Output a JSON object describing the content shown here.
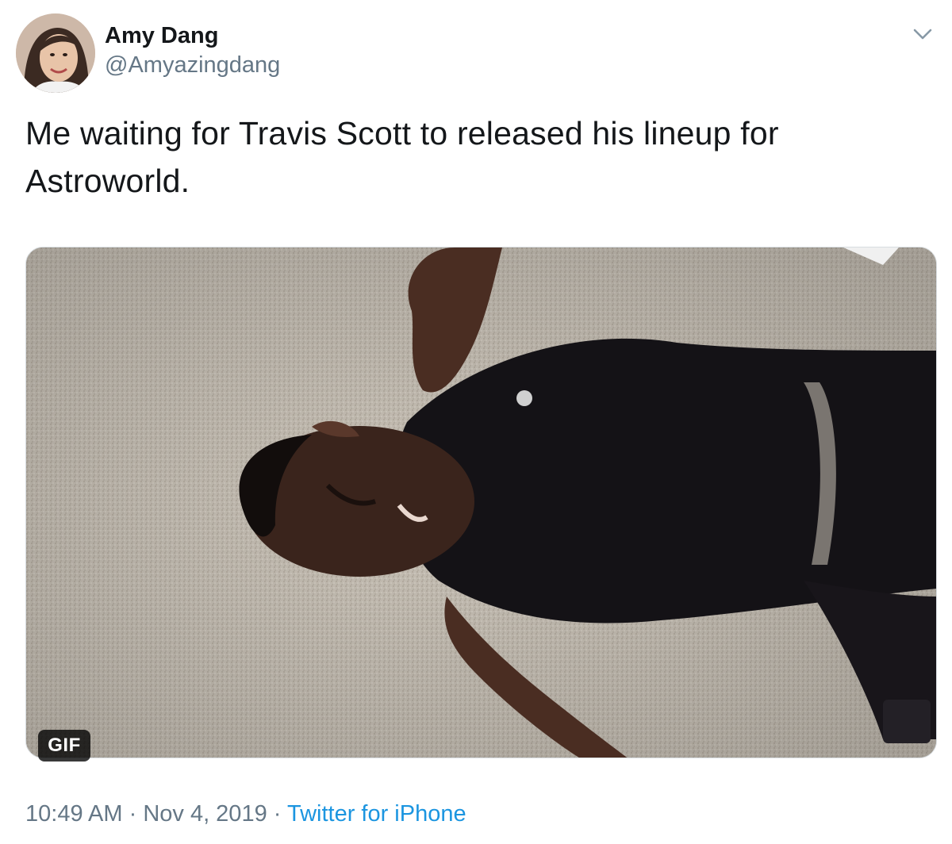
{
  "user": {
    "display_name": "Amy Dang",
    "handle": "@Amyazingdang"
  },
  "tweet": {
    "text": "Me waiting for Travis Scott to released his lineup for Astroworld.",
    "media_badge": "GIF"
  },
  "meta": {
    "time": "10:49 AM",
    "separator_1": " · ",
    "date": "Nov 4, 2019",
    "separator_2": " · ",
    "source": "Twitter for iPhone"
  },
  "icons": {
    "menu": "chevron-down-icon"
  },
  "colors": {
    "text_primary": "#14171a",
    "text_secondary": "#657786",
    "link": "#1b95e0"
  }
}
